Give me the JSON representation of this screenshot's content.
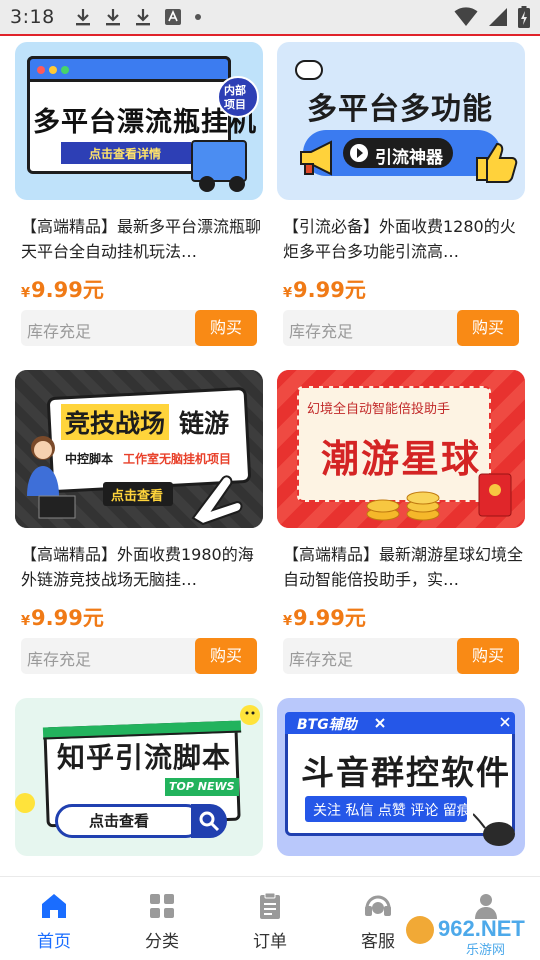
{
  "status_bar": {
    "time": "3:18"
  },
  "products": [
    {
      "thumb_lines": [
        "多平台漂流瓶挂机",
        "点击查看详情",
        "内部",
        "项目"
      ],
      "title": "【高端精品】最新多平台漂流瓶聊天平台全自动挂机玩法…",
      "currency": "¥",
      "price": "9.99元",
      "stock": "库存充足",
      "buy_label": "购买"
    },
    {
      "thumb_lines": [
        "多平台多功能",
        "引流神器"
      ],
      "title": "【引流必备】外面收费1280的火炬多平台多功能引流高…",
      "currency": "¥",
      "price": "9.99元",
      "stock": "库存充足",
      "buy_label": "购买"
    },
    {
      "thumb_lines": [
        "竞技战场",
        "链游",
        "中控脚本",
        "工作室无脑挂机项目",
        "点击查看"
      ],
      "title": "【高端精品】外面收费1980的海外链游竞技战场无脑挂…",
      "currency": "¥",
      "price": "9.99元",
      "stock": "库存充足",
      "buy_label": "购买"
    },
    {
      "thumb_lines": [
        "幻境全自动智能倍投助手",
        "潮游星球"
      ],
      "title": "【高端精品】最新潮游星球幻境全自动智能倍投助手，实…",
      "currency": "¥",
      "price": "9.99元",
      "stock": "库存充足",
      "buy_label": "购买"
    },
    {
      "thumb_lines": [
        "知乎引流脚本",
        "TOP NEWS",
        "点击查看"
      ],
      "title": "",
      "currency": "",
      "price": "",
      "stock": "",
      "buy_label": ""
    },
    {
      "thumb_lines": [
        "BTG辅助",
        "斗音群控软件",
        "关注 私信 点赞 评论 留痕"
      ],
      "title": "",
      "currency": "",
      "price": "",
      "stock": "",
      "buy_label": ""
    }
  ],
  "bottom_nav": [
    {
      "label": "首页",
      "icon": "home-icon",
      "active": true
    },
    {
      "label": "分类",
      "icon": "grid-icon",
      "active": false
    },
    {
      "label": "订单",
      "icon": "clipboard-icon",
      "active": false
    },
    {
      "label": "客服",
      "icon": "headset-icon",
      "active": false
    },
    {
      "label": "",
      "icon": "user-icon",
      "active": false
    }
  ],
  "watermark": {
    "text": "962.NET",
    "subtext": "乐游网"
  },
  "colors": {
    "accent": "#1a6dff",
    "price": "#f07a16",
    "buy": "#f98a15",
    "status_line": "#e0222a"
  }
}
